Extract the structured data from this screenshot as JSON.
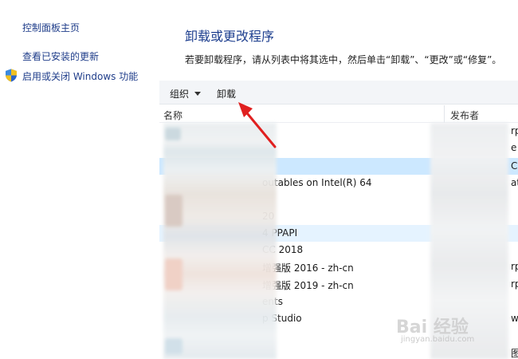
{
  "sidebar": {
    "home_link": "控制面板主页",
    "updates_link": "查看已安装的更新",
    "features_link": "启用或关闭 Windows 功能"
  },
  "main": {
    "title": "卸载或更改程序",
    "description": "若要卸载程序，请从列表中将其选中，然后单击“卸载”、“更改”或“修复”。"
  },
  "toolbar": {
    "organize_label": "组织",
    "uninstall_label": "卸载"
  },
  "columns": {
    "name": "名称",
    "publisher": "发布者"
  },
  "rows": [
    {
      "name": "",
      "publisher": "rp"
    },
    {
      "name": "",
      "publisher": "e"
    },
    {
      "name": "",
      "publisher": "C"
    },
    {
      "name": "outables on Intel(R) 64",
      "publisher": "ati"
    },
    {
      "name": "",
      "publisher": ""
    },
    {
      "name": "20",
      "publisher": ""
    },
    {
      "name": "4 PPAPI",
      "publisher": ""
    },
    {
      "name": "CC 2018",
      "publisher": ""
    },
    {
      "name": "增强版 2016  - zh-cn",
      "publisher": "rp"
    },
    {
      "name": "增强版 2019 - zh-cn",
      "publisher": "rp"
    },
    {
      "name": "ents",
      "publisher": ""
    },
    {
      "name": "p Studio",
      "publisher": "wa"
    },
    {
      "name": "",
      "publisher": ""
    },
    {
      "name": "",
      "publisher": "图"
    }
  ],
  "watermark": {
    "brand": "Bai 经验",
    "url": "jingyan.baidu.com"
  },
  "colors": {
    "link": "#1f3d8a",
    "title": "#1e3f8f",
    "selected_row": "#cce8ff",
    "hover_row": "#e5f3ff",
    "arrow": "#e02020"
  }
}
